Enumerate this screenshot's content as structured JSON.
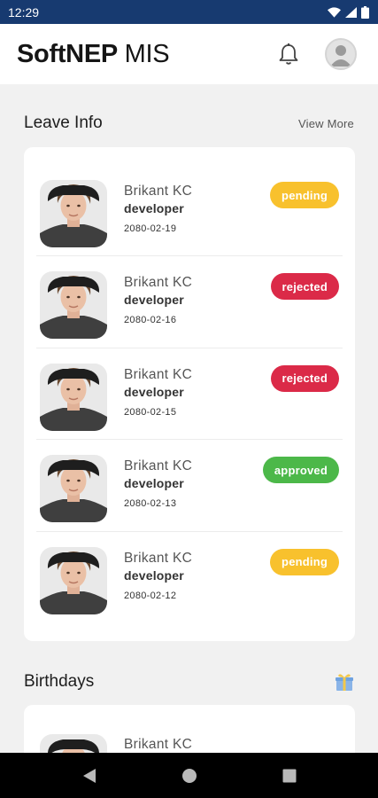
{
  "status_bar": {
    "time": "12:29"
  },
  "header": {
    "title_bold": "SoftNEP",
    "title_regular": " MIS"
  },
  "leave_info": {
    "title": "Leave Info",
    "view_more": "View More",
    "items": [
      {
        "name": "Brikant KC",
        "role": "developer",
        "date": "2080-02-19",
        "status": "pending",
        "status_color": "#f8c12d"
      },
      {
        "name": "Brikant KC",
        "role": "developer",
        "date": "2080-02-16",
        "status": "rejected",
        "status_color": "#db2a48"
      },
      {
        "name": "Brikant KC",
        "role": "developer",
        "date": "2080-02-15",
        "status": "rejected",
        "status_color": "#db2a48"
      },
      {
        "name": "Brikant KC",
        "role": "developer",
        "date": "2080-02-13",
        "status": "approved",
        "status_color": "#4cb849"
      },
      {
        "name": "Brikant KC",
        "role": "developer",
        "date": "2080-02-12",
        "status": "pending",
        "status_color": "#f8c12d"
      }
    ]
  },
  "birthdays": {
    "title": "Birthdays",
    "items": [
      {
        "name": "Brikant KC"
      }
    ]
  },
  "icons": {
    "notification": "bell-icon",
    "profile": "person-icon",
    "birthday": "gift-icon",
    "nav_back": "back-triangle-icon",
    "nav_home": "home-circle-icon",
    "nav_recents": "recents-square-icon"
  },
  "colors": {
    "status_bar": "#173a70",
    "pending": "#f8c12d",
    "rejected": "#db2a48",
    "approved": "#4cb849"
  }
}
